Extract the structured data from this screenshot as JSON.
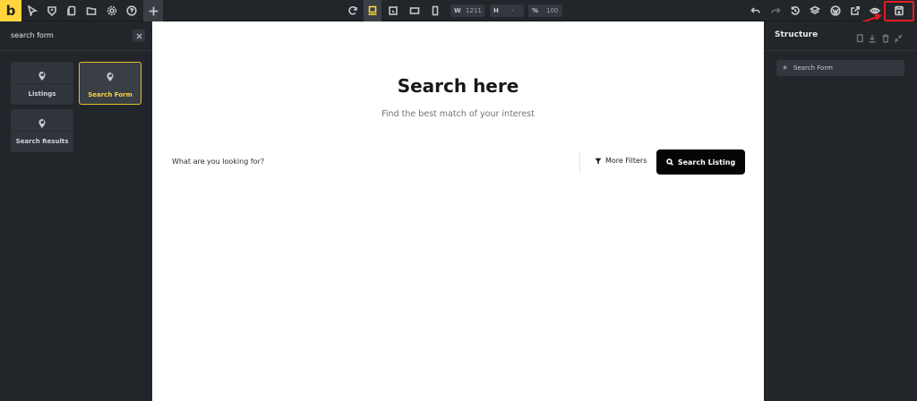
{
  "app": {
    "logo_letter": "b"
  },
  "toolbar": {
    "width_label": "W",
    "width_value": "1211",
    "height_label": "H",
    "height_value": "-",
    "zoom_label": "%",
    "zoom_value": "100"
  },
  "left_panel": {
    "search": {
      "value": "search form"
    },
    "elements": [
      {
        "label": "Listings",
        "icon": "pin-search-icon",
        "selected": false
      },
      {
        "label": "Search Form",
        "icon": "pin-search-icon",
        "selected": true
      },
      {
        "label": "Search Results",
        "icon": "pin-search-icon",
        "selected": false
      }
    ]
  },
  "canvas": {
    "heading": "Search here",
    "subheading": "Find the best match of your interest",
    "search_placeholder": "What are you looking for?",
    "filters_label": "More Filters",
    "search_button": "Search Listing"
  },
  "right_panel": {
    "title": "Structure",
    "tree": [
      {
        "label": "Search Form"
      }
    ]
  },
  "colors": {
    "accent": "#ffd53e",
    "panel": "#22262b",
    "highlight": "#e41b23"
  }
}
